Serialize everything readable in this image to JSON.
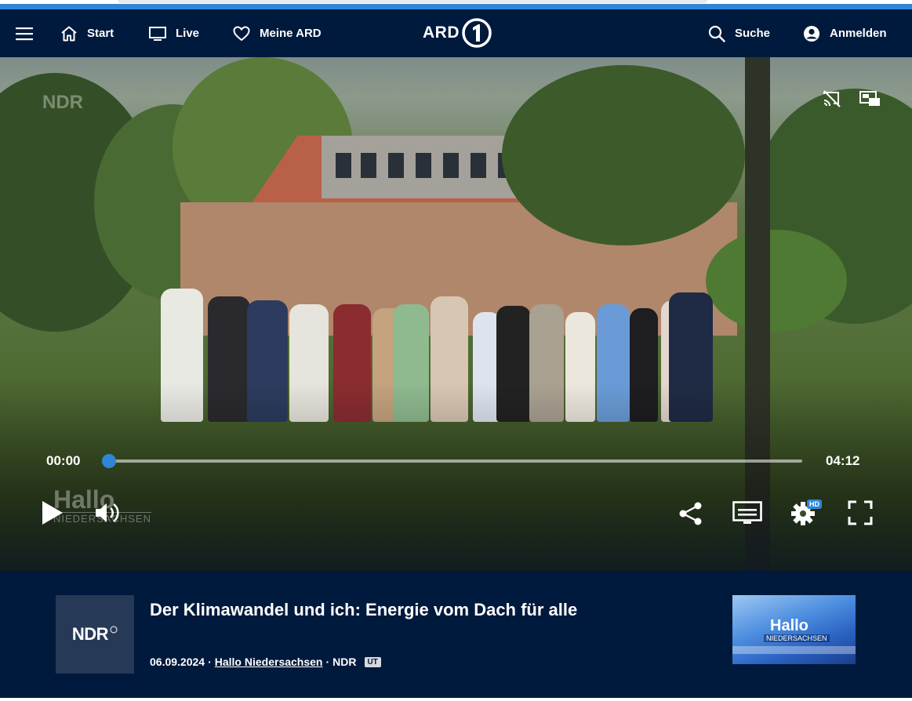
{
  "nav": {
    "menu_icon": "hamburger-menu-icon",
    "start_label": "Start",
    "live_label": "Live",
    "meine_label": "Meine ARD",
    "logo_text": "ARD",
    "search_label": "Suche",
    "login_label": "Anmelden"
  },
  "player": {
    "watermark_channel": "NDR",
    "watermark_show_line1": "Hallo",
    "watermark_show_line2": "NIEDERSACHSEN",
    "current_time": "00:00",
    "duration": "04:12",
    "progress_fraction": 0.0,
    "hd_badge": "HD",
    "accent_color": "#2f86d6"
  },
  "info": {
    "channel_logo_text": "NDR",
    "title": "Der Klimawandel und ich: Energie vom Dach für alle",
    "date": "06.09.2024",
    "separator": "·",
    "show_link": "Hallo Niedersachsen",
    "channel": "NDR",
    "subtitle_badge": "UT",
    "thumb_line1": "Hallo",
    "thumb_line2": "NIEDERSACHSEN"
  },
  "colors": {
    "nav_bg": "#001a3d",
    "info_bg": "#001a3d"
  }
}
